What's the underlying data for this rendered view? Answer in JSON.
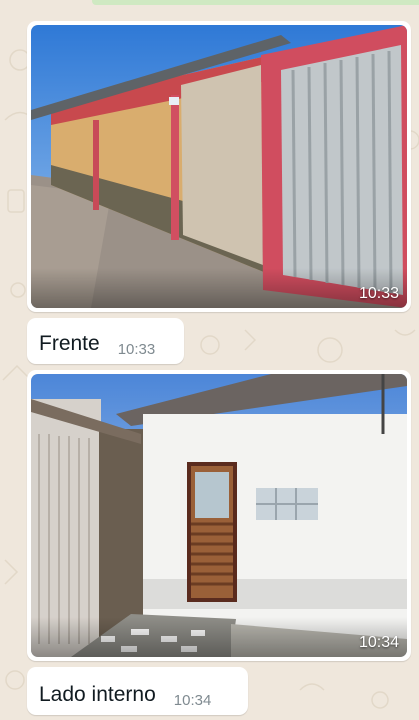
{
  "chat": {
    "messages": [
      {
        "type": "image",
        "time": "10:33",
        "image_description": "front-wall-photo"
      },
      {
        "type": "text",
        "text": "Frente",
        "time": "10:33"
      },
      {
        "type": "image",
        "time": "10:34",
        "image_description": "inner-courtyard-photo"
      },
      {
        "type": "text",
        "text": "Lado interno",
        "time": "10:34"
      }
    ]
  },
  "colors": {
    "wallpaper": "#efe7dc",
    "bubble": "#ffffff",
    "caption_time": "#7f8a90"
  }
}
